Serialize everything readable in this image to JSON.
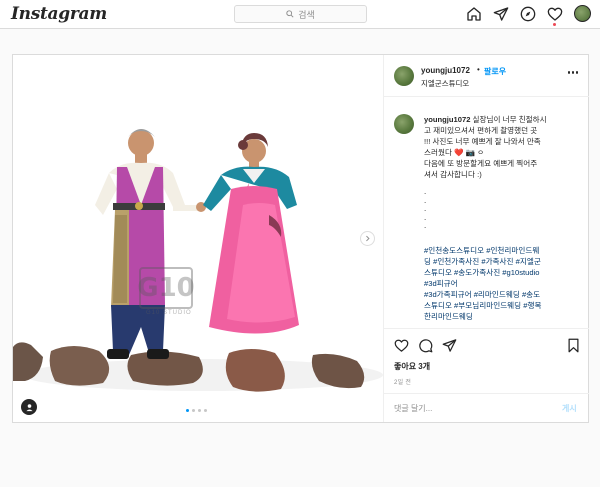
{
  "nav": {
    "logo": "Instagram",
    "search_placeholder": "검색"
  },
  "post": {
    "username": "youngju1072",
    "separator": "•",
    "follow_label": "팔로우",
    "location": "지엘군스튜디오",
    "caption": {
      "username": "youngju1072",
      "lines": [
        "실장님이 너무 친절하시",
        "고 재미있으셔서 편하게 촬영했던 곳",
        "!!! 사진도 너무 예쁘게 잘 나와서 만족",
        "스러웠다 ❤️ 📷 ㅇ",
        "다음에 또 방문할게요 예쁘게 찍어주",
        "셔서 감사합니다 :)"
      ],
      "dots": [
        ".",
        ".",
        ".",
        ".",
        "."
      ]
    },
    "hashtags": [
      "#인천송도스튜디오 #인천리마인드웨",
      "딩 #인천가족사진 #가족사진 #지엘군",
      "스튜디오 #송도가족사진 #g10studio",
      "#3d피규어",
      "#3d가족피규어 #리마인드웨딩 #송도",
      "스튜디오 #부모님리마인드웨딩 #행복",
      "한리마인드웨딩"
    ],
    "likes": "좋아요 3개",
    "date": "2일 전",
    "comment_placeholder": "댓글 달기...",
    "post_button": "게시"
  },
  "photo": {
    "watermark": "G10",
    "watermark_sub": "G10 STUDIO",
    "carousel_total": 4,
    "carousel_active": 1
  },
  "colors": {
    "link_blue": "#0095f6",
    "hashtag_blue": "#00376b",
    "notification_red": "#ed4956"
  },
  "icons": [
    "home-icon",
    "direct-icon",
    "explore-icon",
    "heart-icon",
    "avatar-icon",
    "search-icon",
    "more-icon",
    "like-icon",
    "comment-icon",
    "share-icon",
    "save-icon",
    "tag-user-icon",
    "chevron-right-icon"
  ]
}
